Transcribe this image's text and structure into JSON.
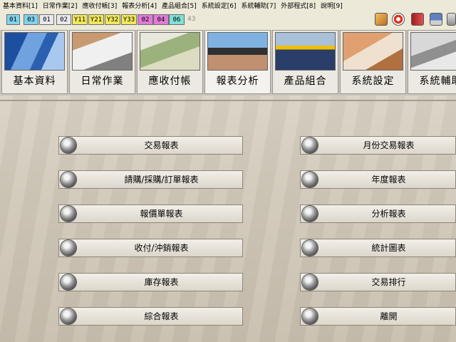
{
  "menu": [
    "基本資料[1]",
    "日常作業[2]",
    "應收付帳[3]",
    "報表分析[4]",
    "產品組合[5]",
    "系統設定[6]",
    "系統輔助[7]",
    "外部程式[8]",
    "說明[9]"
  ],
  "toolbar": {
    "buttons": [
      {
        "label": "01",
        "color": "#7fd4f0"
      },
      {
        "label": "03",
        "color": "#7fd4f0"
      },
      {
        "label": "01",
        "color": "#e8e8f0"
      },
      {
        "label": "02",
        "color": "#e8e8f0"
      },
      {
        "label": "Y11",
        "color": "#f2e85a"
      },
      {
        "label": "Y21",
        "color": "#f2e85a"
      },
      {
        "label": "Y32",
        "color": "#f2e85a"
      },
      {
        "label": "Y33",
        "color": "#f2e85a"
      },
      {
        "label": "02",
        "color": "#e07ad8"
      },
      {
        "label": "04",
        "color": "#e07ad8"
      },
      {
        "label": "06",
        "color": "#7fe0d8"
      }
    ],
    "trailing_number": "43",
    "right_icons": [
      "box-icon",
      "lifebuoy-icon",
      "book-icon",
      "computer-icon",
      "calculator-icon"
    ]
  },
  "tabs": [
    {
      "label": "基本資料",
      "image": "building"
    },
    {
      "label": "日常作業",
      "image": "keyboard"
    },
    {
      "label": "應收付帳",
      "image": "money"
    },
    {
      "label": "報表分析",
      "image": "laptop"
    },
    {
      "label": "產品組合",
      "image": "workers"
    },
    {
      "label": "系統設定",
      "image": "mouse-hand"
    },
    {
      "label": "系統輔助",
      "image": "calculator"
    }
  ],
  "active_tab": "報表分析",
  "left_buttons": [
    "交易報表",
    "請購/採購/訂單報表",
    "報價單報表",
    "收付/沖銷報表",
    "庫存報表",
    "綜合報表"
  ],
  "right_buttons": [
    "月份交易報表",
    "年度報表",
    "分析報表",
    "統計圖表",
    "交易排行",
    "離開"
  ]
}
